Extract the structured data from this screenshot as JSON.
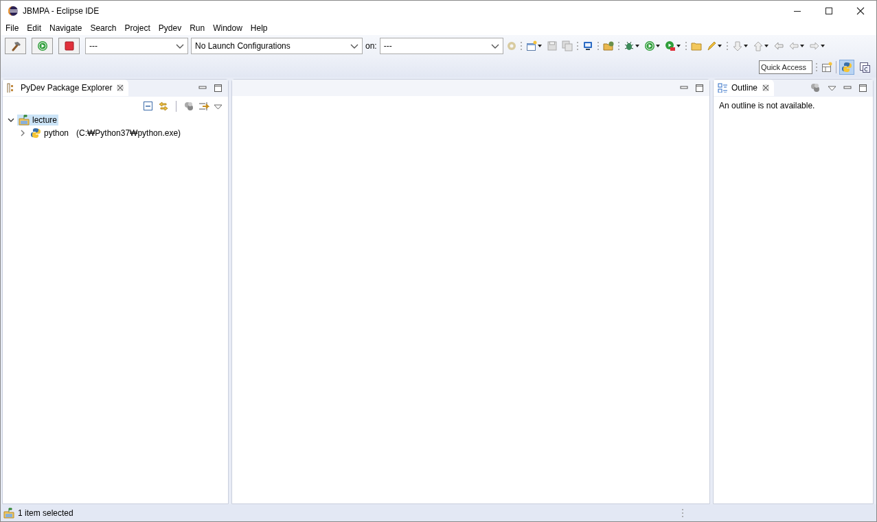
{
  "window": {
    "title": "JBMPA - Eclipse IDE"
  },
  "menu": [
    "File",
    "Edit",
    "Navigate",
    "Search",
    "Project",
    "Pydev",
    "Run",
    "Window",
    "Help"
  ],
  "launch_bar": {
    "mode_combo": {
      "value": "---"
    },
    "config_combo": {
      "value": "No Launch Configurations"
    },
    "target_label": "on:",
    "target_combo": {
      "value": "---"
    }
  },
  "quick_access": {
    "placeholder": "Quick Access"
  },
  "perspectives": [
    {
      "selected": true
    },
    {
      "selected": false
    }
  ],
  "explorer": {
    "title": "PyDev Package Explorer",
    "tree": [
      {
        "label": "lecture",
        "selected": true,
        "expanded": true,
        "children": [
          {
            "label": "python",
            "detail": "(C:₩Python37₩python.exe)",
            "selected": false,
            "expanded": false
          }
        ]
      }
    ]
  },
  "outline": {
    "title": "Outline",
    "message": "An outline is not available."
  },
  "status_bar": {
    "text": "1 item selected"
  }
}
